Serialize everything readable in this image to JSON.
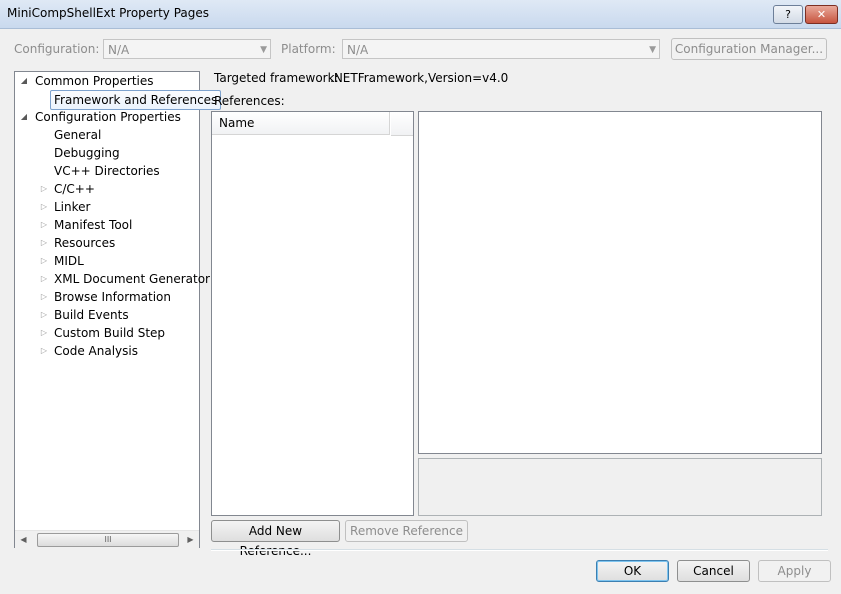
{
  "window": {
    "title": "MiniCompShellExt Property Pages",
    "help_label": "?",
    "close_label": "✕"
  },
  "toolbar": {
    "configuration_label": "Configuration:",
    "configuration_value": "N/A",
    "platform_label": "Platform:",
    "platform_value": "N/A",
    "configuration_manager_label": "Configuration Manager..."
  },
  "tree": {
    "common_properties": "Common Properties",
    "framework_and_references": "Framework and References",
    "configuration_properties": "Configuration Properties",
    "general": "General",
    "debugging": "Debugging",
    "vc_directories": "VC++ Directories",
    "cpp": "C/C++",
    "linker": "Linker",
    "manifest_tool": "Manifest Tool",
    "resources": "Resources",
    "midl": "MIDL",
    "xml_doc_gen": "XML Document Generator",
    "browse_info": "Browse Information",
    "build_events": "Build Events",
    "custom_build_step": "Custom Build Step",
    "code_analysis": "Code Analysis"
  },
  "main": {
    "targeted_framework_label": "Targeted framework:",
    "targeted_framework_value": ".NETFramework,Version=v4.0",
    "references_label": "References:",
    "name_column": "Name",
    "add_new_reference": "Add New Reference...",
    "remove_reference": "Remove Reference"
  },
  "footer": {
    "ok": "OK",
    "cancel": "Cancel",
    "apply": "Apply"
  },
  "scrollbar": {
    "left_arrow": "◀",
    "right_arrow": "▶",
    "grip": "III"
  }
}
